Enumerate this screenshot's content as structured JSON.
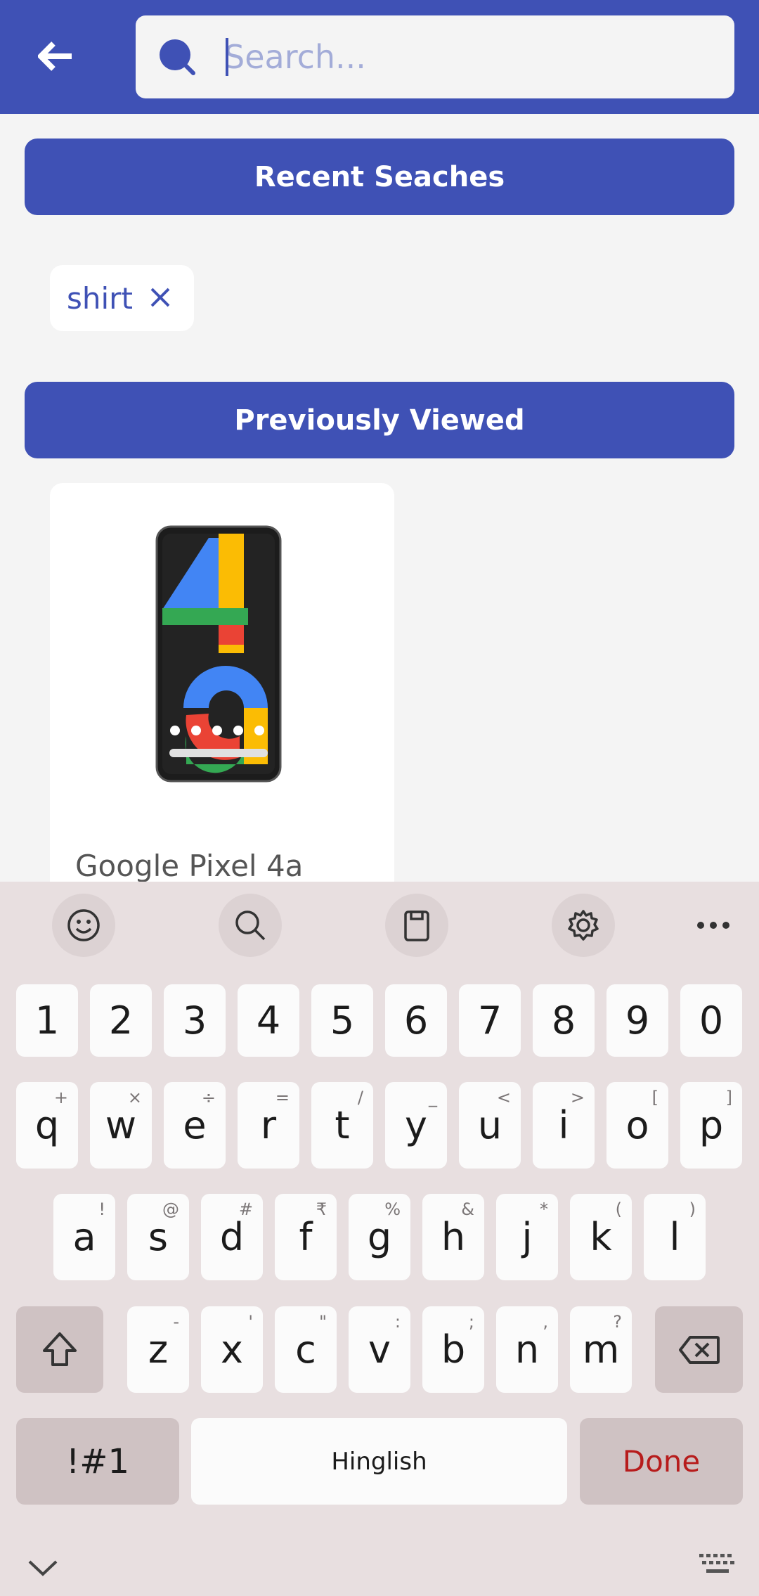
{
  "colors": {
    "primary": "#3f51b5",
    "background": "#f4f4f4",
    "keyboard_bg": "#e8dfe0",
    "done_red": "#b71c1c"
  },
  "header": {
    "back_icon": "arrow-left-icon",
    "search": {
      "placeholder": "Search...",
      "value": "",
      "icon": "search-icon"
    }
  },
  "recent_searches": {
    "title": "Recent Seaches",
    "chips": [
      {
        "label": "shirt",
        "remove_icon": "close-icon"
      }
    ]
  },
  "previously_viewed": {
    "title": "Previously Viewed",
    "products": [
      {
        "name": "Google Pixel 4a",
        "image": "phone-icon"
      }
    ]
  },
  "keyboard": {
    "toolbar": [
      "emoji-icon",
      "search-icon",
      "clipboard-icon",
      "gear-icon",
      "more-icon"
    ],
    "numbers": [
      "1",
      "2",
      "3",
      "4",
      "5",
      "6",
      "7",
      "8",
      "9",
      "0"
    ],
    "row1": [
      {
        "key": "q",
        "hint": "+"
      },
      {
        "key": "w",
        "hint": "×"
      },
      {
        "key": "e",
        "hint": "÷"
      },
      {
        "key": "r",
        "hint": "="
      },
      {
        "key": "t",
        "hint": "/"
      },
      {
        "key": "y",
        "hint": "_"
      },
      {
        "key": "u",
        "hint": "<"
      },
      {
        "key": "i",
        "hint": ">"
      },
      {
        "key": "o",
        "hint": "["
      },
      {
        "key": "p",
        "hint": "]"
      }
    ],
    "row2": [
      {
        "key": "a",
        "hint": "!"
      },
      {
        "key": "s",
        "hint": "@"
      },
      {
        "key": "d",
        "hint": "#"
      },
      {
        "key": "f",
        "hint": "₹"
      },
      {
        "key": "g",
        "hint": "%"
      },
      {
        "key": "h",
        "hint": "&"
      },
      {
        "key": "j",
        "hint": "*"
      },
      {
        "key": "k",
        "hint": "("
      },
      {
        "key": "l",
        "hint": ")"
      }
    ],
    "row3": [
      {
        "key": "z",
        "hint": "-"
      },
      {
        "key": "x",
        "hint": "'"
      },
      {
        "key": "c",
        "hint": "\""
      },
      {
        "key": "v",
        "hint": ":"
      },
      {
        "key": "b",
        "hint": ";"
      },
      {
        "key": "n",
        "hint": ","
      },
      {
        "key": "m",
        "hint": "?"
      }
    ],
    "symbols_label": "!#1",
    "space_label": "Hinglish",
    "done_label": "Done"
  }
}
